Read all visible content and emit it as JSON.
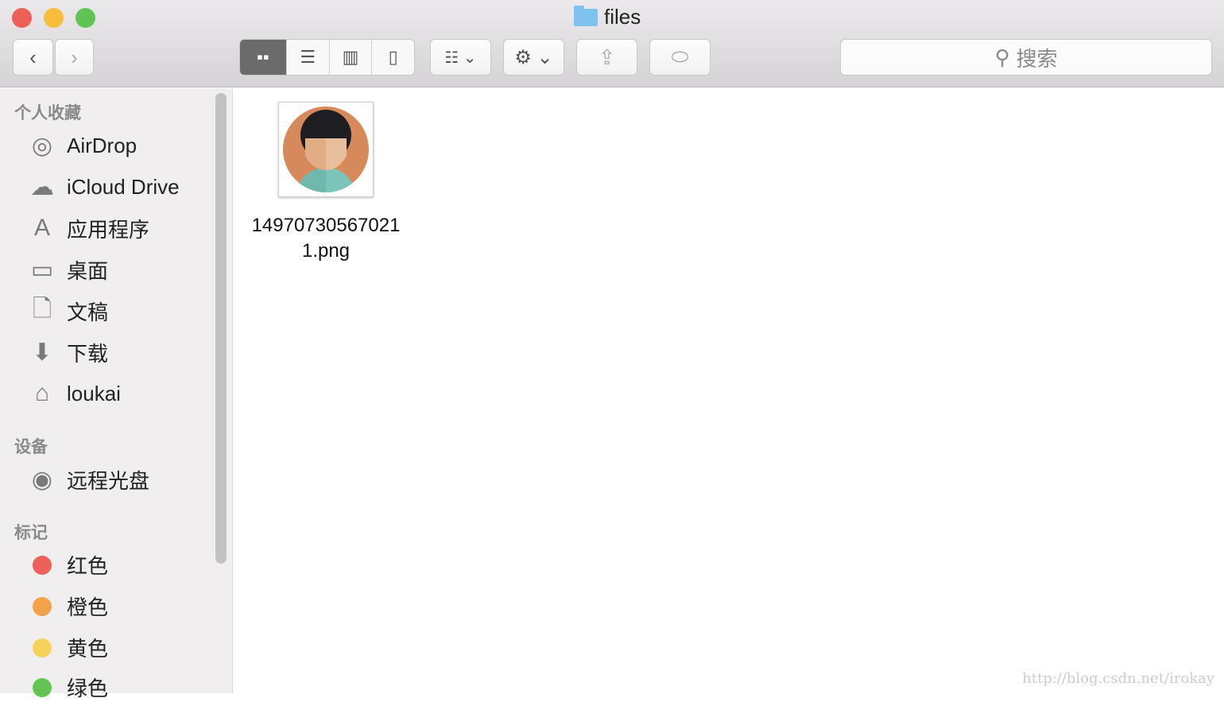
{
  "window": {
    "title": "files",
    "traffic_lights": {
      "close": "#ee5f57",
      "minimize": "#f6be3a",
      "zoom": "#5fc453"
    }
  },
  "toolbar": {
    "back": "chevron-left-icon",
    "forward": "chevron-right-icon",
    "views": [
      "icon-view",
      "list-view",
      "column-view",
      "cover-flow-view"
    ],
    "active_view": "icon-view",
    "search_placeholder": "搜索"
  },
  "sidebar": {
    "favorites_header": "个人收藏",
    "favorites": [
      {
        "label": "AirDrop",
        "icon": "airdrop-icon"
      },
      {
        "label": "iCloud Drive",
        "icon": "cloud-icon"
      },
      {
        "label": "应用程序",
        "icon": "applications-icon"
      },
      {
        "label": "桌面",
        "icon": "desktop-icon"
      },
      {
        "label": "文稿",
        "icon": "documents-icon"
      },
      {
        "label": "下载",
        "icon": "download-icon"
      },
      {
        "label": "loukai",
        "icon": "home-icon"
      }
    ],
    "devices_header": "设备",
    "devices": [
      {
        "label": "远程光盘",
        "icon": "disc-icon"
      }
    ],
    "tags_header": "标记",
    "tags": [
      {
        "label": "红色",
        "color": "#f0605a"
      },
      {
        "label": "橙色",
        "color": "#f4a24a"
      },
      {
        "label": "黄色",
        "color": "#f5d35b"
      },
      {
        "label": "绿色",
        "color": "#63c454"
      }
    ]
  },
  "files": [
    {
      "name": "14970730567021 1.png",
      "name_line1": "14970730567021",
      "name_line2": "1.png"
    }
  ],
  "watermark": "http://blog.csdn.net/irokay"
}
